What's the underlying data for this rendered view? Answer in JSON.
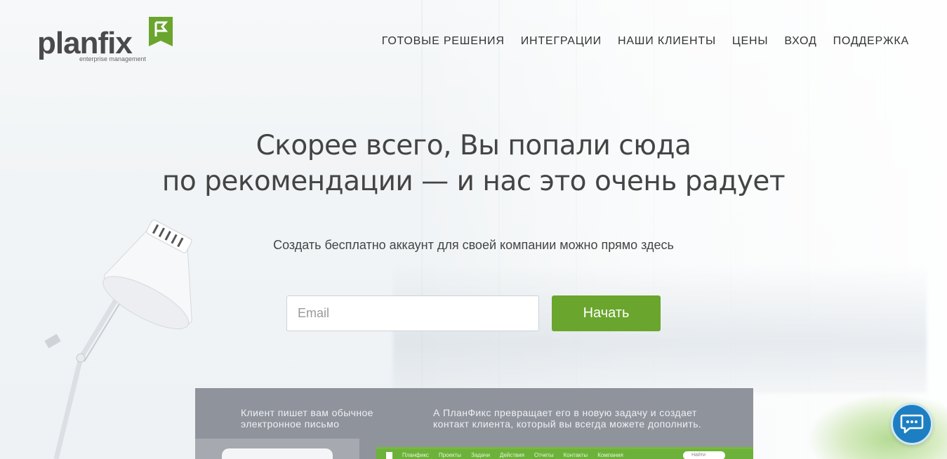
{
  "brand": {
    "name": "planfix",
    "tagline": "enterprise management",
    "accent_color": "#6aa52d"
  },
  "nav": {
    "items": [
      {
        "label": "ГОТОВЫЕ РЕШЕНИЯ"
      },
      {
        "label": "ИНТЕГРАЦИИ"
      },
      {
        "label": "НАШИ КЛИЕНТЫ"
      },
      {
        "label": "ЦЕНЫ"
      },
      {
        "label": "ВХОД"
      },
      {
        "label": "ПОДДЕРЖКА"
      }
    ]
  },
  "hero": {
    "title_line1": "Скорее всего, Вы попали сюда",
    "title_line2": "по рекомендации — и нас это очень радует",
    "subtitle": "Создать бесплатно аккаунт для своей компании можно прямо здесь",
    "email_placeholder": "Email",
    "start_button": "Начать"
  },
  "demo": {
    "caption_left": "Клиент пишет вам обычное электронное письмо",
    "caption_right": "А ПланФикс превращает его в новую задачу и создает контакт клиента, который вы всегда можете дополнить.",
    "app_menu": [
      "Планфикс",
      "Проекты",
      "Задачи",
      "Действия",
      "Отчеты",
      "Контакты",
      "Компания"
    ],
    "search_placeholder": "Найти"
  },
  "chat": {
    "icon": "chat-bubble-icon",
    "color": "#1d7fc2"
  }
}
